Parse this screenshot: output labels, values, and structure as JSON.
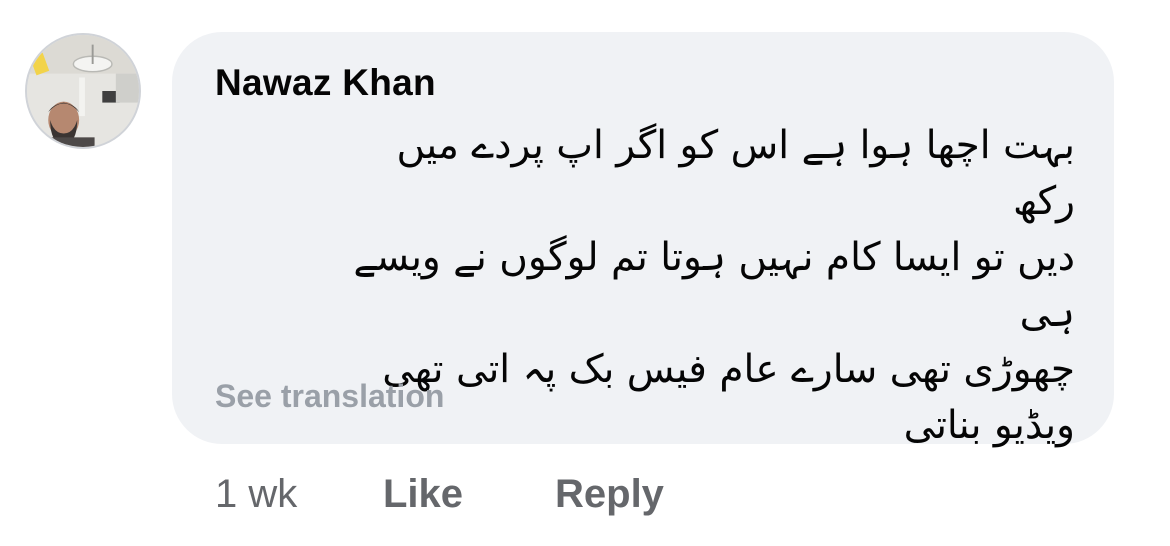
{
  "comment": {
    "author": "Nawaz Khan",
    "text": "بہت اچھا ہوا ہے اس کو اگر اپ پردے میں رکھ\nدیں تو ایسا کام نہیں ہوتا تم لوگوں نے ویسے ہی\nچھوڑی تھی سارے عام فیس بک پہ اتی تھی\nویڈیو بناتی",
    "see_translation": "See translation",
    "timestamp": "1 wk",
    "like_label": "Like",
    "reply_label": "Reply"
  },
  "colors": {
    "bubble_background": "#f0f2f5",
    "author_text": "#050505",
    "secondary_text": "#65676b",
    "translation_link": "#9aa0a8"
  },
  "icons": {
    "avatar": "profile-photo"
  }
}
